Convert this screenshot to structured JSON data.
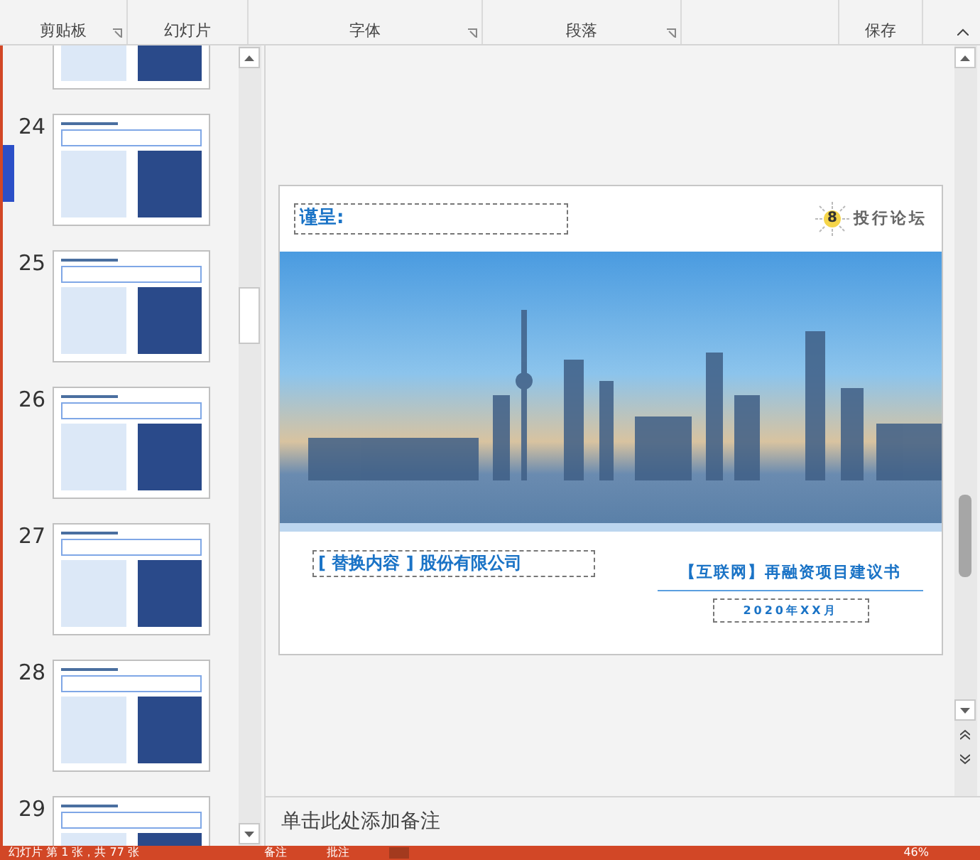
{
  "ribbon": {
    "groups": [
      {
        "label": "剪贴板",
        "launcher": true
      },
      {
        "label": "幻灯片",
        "launcher": false
      },
      {
        "label": "字体",
        "launcher": true
      },
      {
        "label": "段落",
        "launcher": true
      },
      {
        "label": "保存",
        "launcher": false
      }
    ]
  },
  "thumbnails": [
    {
      "number": "24"
    },
    {
      "number": "25"
    },
    {
      "number": "26"
    },
    {
      "number": "27"
    },
    {
      "number": "28"
    },
    {
      "number": "29"
    }
  ],
  "slide": {
    "presented_to": "谨呈:",
    "logo_badge": "8",
    "logo_text": "投行论坛",
    "company": "[ 替换内容 ] 股份有限公司",
    "doc_title": "【互联网】再融资项目建议书",
    "date": "2020年XX月"
  },
  "notes_placeholder": "单击此处添加备注",
  "status_bar": {
    "slide_info": "幻灯片 第 1 张，共 77 张",
    "notes": "备注",
    "comments": "批注",
    "zoom": "46%"
  }
}
